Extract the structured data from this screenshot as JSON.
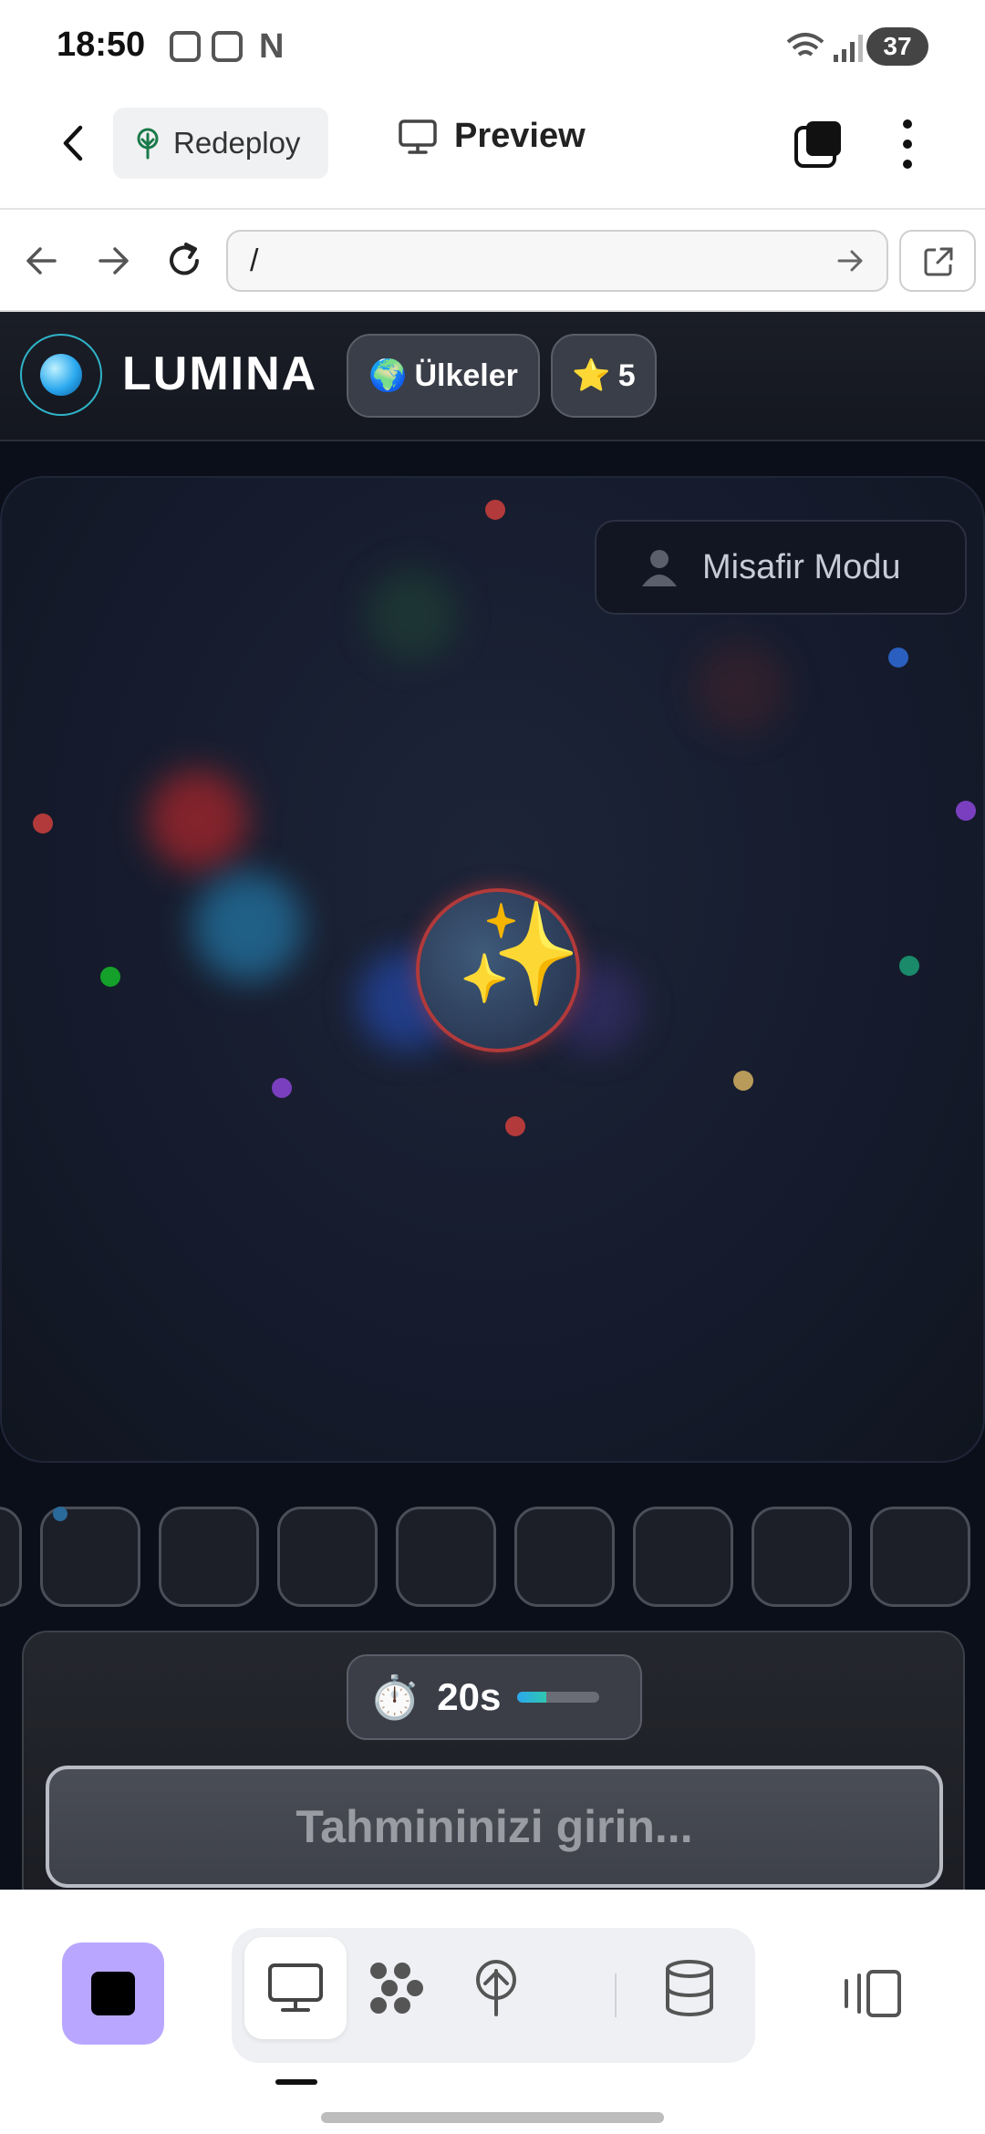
{
  "status_bar": {
    "time": "18:50",
    "battery": "37"
  },
  "app_bar": {
    "redeploy_label": "Redeploy",
    "preview_label": "Preview"
  },
  "url_bar": {
    "url": "/"
  },
  "game": {
    "logo_text": "LUMINA",
    "category": {
      "icon": "globe-icon",
      "label": "Ülkeler"
    },
    "stars": {
      "icon": "star-icon",
      "count": "5"
    },
    "guest_mode_label": "Misafir Modu",
    "timer": {
      "label": "20s",
      "progress": 0.35
    },
    "guess_placeholder": "Tahmininizi girin...",
    "slot_count": 9
  },
  "colors": {
    "accent": "#b9a7ff",
    "board_bg": "#151b2c",
    "orb_border": "#b23a3a",
    "logo_ring": "#2fb3c8"
  }
}
